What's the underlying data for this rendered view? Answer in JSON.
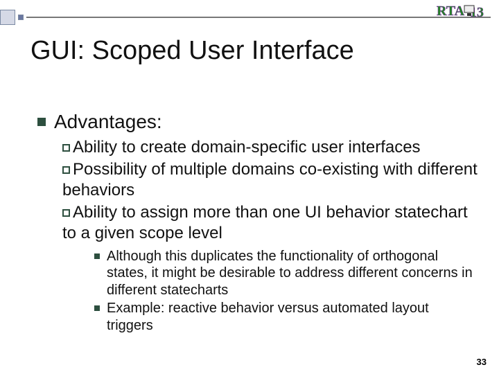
{
  "title": "GUI: Scoped User Interface",
  "lvl1": {
    "heading": "Advantages:"
  },
  "lvl2": {
    "items": [
      "Ability to create domain-specific user interfaces",
      "Possibility of multiple domains co-existing with different behaviors",
      "Ability to assign more than one UI behavior statechart to a given scope level"
    ]
  },
  "lvl3": {
    "items": [
      "Although this duplicates the functionality of orthogonal states, it might be desirable to address different concerns in different statecharts",
      "Example: reactive behavior versus automated layout triggers"
    ]
  },
  "page_number": "33",
  "logo_text": "RTA '13"
}
